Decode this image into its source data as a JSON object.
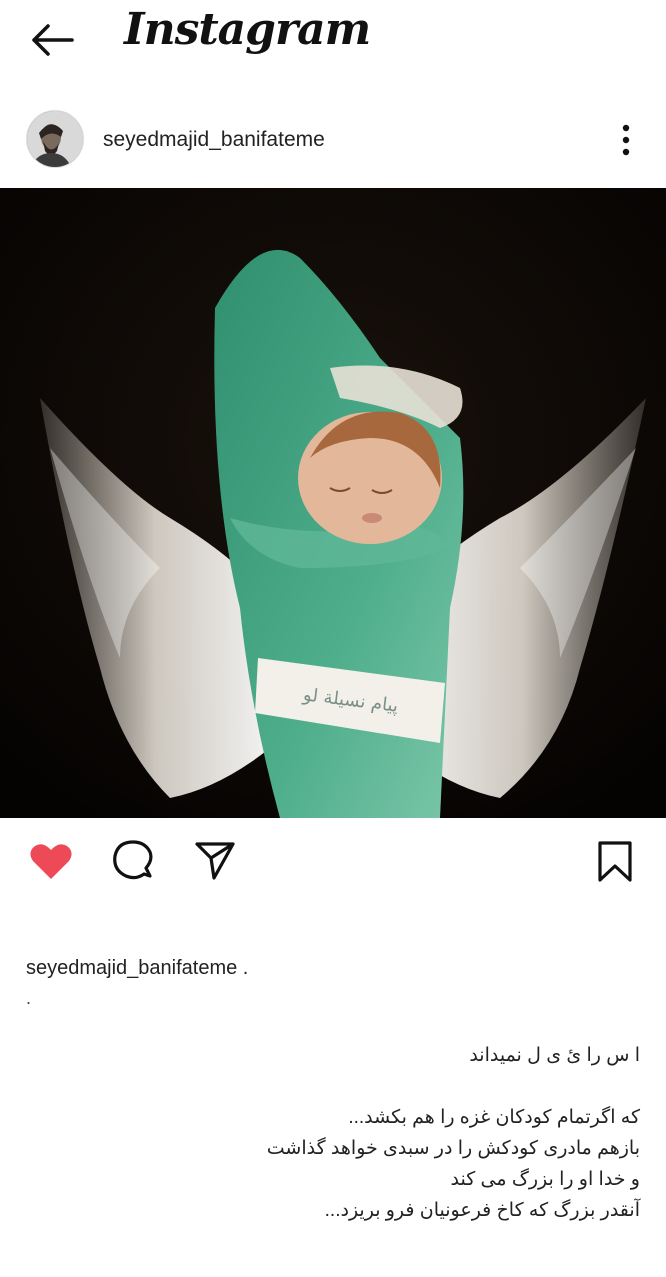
{
  "app": {
    "title": "Instagram"
  },
  "post": {
    "username": "seyedmajid_banifateme",
    "image_label_text": "پیام نسیلة لو"
  },
  "caption": {
    "username": "seyedmajid_banifateme .",
    "dot": ".",
    "lines": [
      "ا س را ئ ی ل نمیداند",
      "",
      "که اگرتمام کودکان غزه را هم بکشد...",
      "بازهم مادری کودکش را در سبدی خواهد گذاشت",
      "و خدا او را بزرگ می کند",
      "آنقدر بزرگ که کاخ فرعونیان فرو بریزد..."
    ]
  },
  "colors": {
    "like": "#ed4956",
    "text": "#222222",
    "image_bg": "#0a0705",
    "cloth": "#3fa383"
  },
  "icons": [
    "back-arrow-icon",
    "more-options-icon",
    "heart-icon",
    "comment-icon",
    "share-icon",
    "bookmark-icon"
  ],
  "state": {
    "liked": true
  }
}
